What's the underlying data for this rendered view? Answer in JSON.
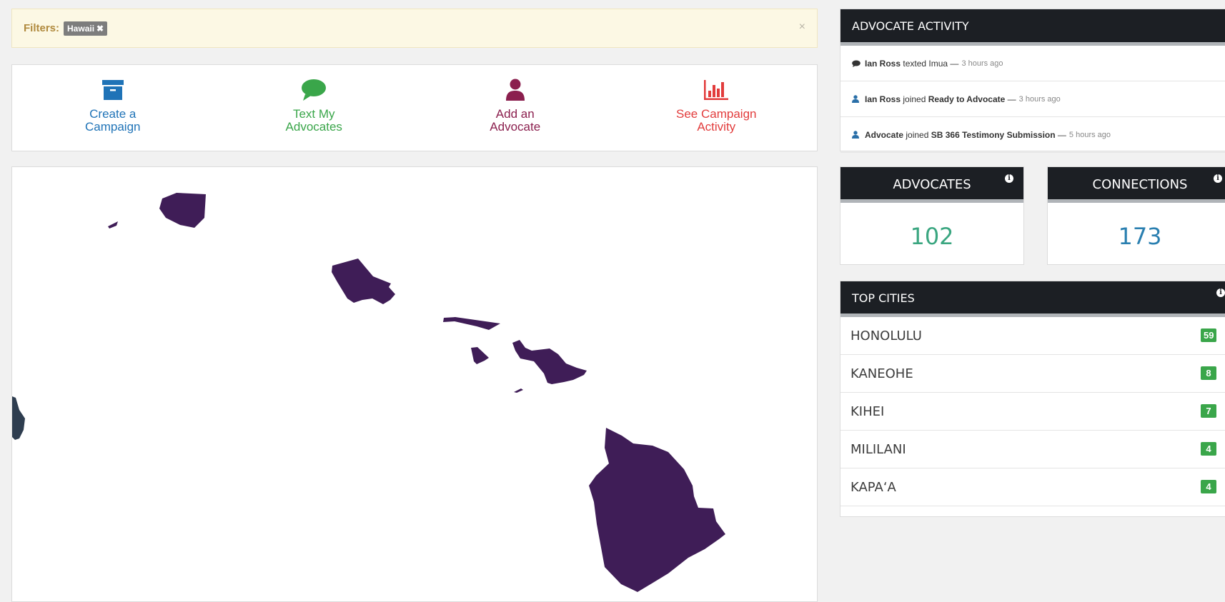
{
  "filters": {
    "label": "Filters:",
    "chip": "Hawaii",
    "close": "×"
  },
  "actions": [
    {
      "label": "Create a\nCampaign",
      "color": "#1f73b7",
      "icon": "archive-box-icon"
    },
    {
      "label": "Text My\nAdvocates",
      "color": "#3aa64a",
      "icon": "chat-bubble-icon"
    },
    {
      "label": "Add an\nAdvocate",
      "color": "#8b1f4e",
      "icon": "user-icon"
    },
    {
      "label": "See Campaign\nActivity",
      "color": "#e23c3c",
      "icon": "bar-chart-icon"
    }
  ],
  "activity": {
    "title": "ADVOCATE ACTIVITY",
    "items": [
      {
        "icon": "comment-icon",
        "actor": "Ian Ross",
        "verb": "texted",
        "target_plain": "Imua",
        "target_bold": "",
        "time": "3 hours ago"
      },
      {
        "icon": "user-icon",
        "actor": "Ian Ross",
        "verb": "joined",
        "target_plain": "",
        "target_bold": "Ready to Advocate",
        "time": "3 hours ago"
      },
      {
        "icon": "user-icon",
        "actor": "Advocate",
        "verb": "joined",
        "target_plain": "",
        "target_bold": "SB 366 Testimony Submission",
        "time": "5 hours ago"
      }
    ]
  },
  "stats": {
    "advocates": {
      "title": "ADVOCATES",
      "value": "102",
      "color": "#3aa680"
    },
    "connections": {
      "title": "CONNECTIONS",
      "value": "173",
      "color": "#2a7fb0"
    }
  },
  "cities": {
    "title": "TOP CITIES",
    "rows": [
      {
        "name": "HONOLULU",
        "count": "59"
      },
      {
        "name": "KANEOHE",
        "count": "8"
      },
      {
        "name": "KIHEI",
        "count": "7"
      },
      {
        "name": "MILILANI",
        "count": "4"
      },
      {
        "name": "KAPA‘A",
        "count": "4"
      }
    ]
  },
  "map": {
    "fill": "#3f1d57",
    "other_fill": "#2e3d4f"
  }
}
